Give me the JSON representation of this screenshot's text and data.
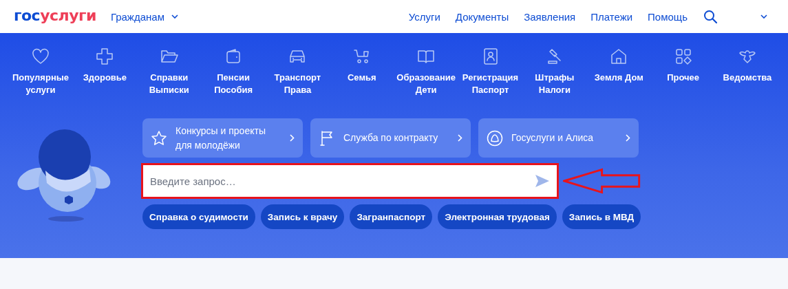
{
  "header": {
    "logo": {
      "prefix": "гос",
      "suffix": "услуги"
    },
    "audience": {
      "label": "Гражданам"
    },
    "nav": [
      "Услуги",
      "Документы",
      "Заявления",
      "Платежи",
      "Помощь"
    ]
  },
  "categories": [
    {
      "label": "Популярные услуги"
    },
    {
      "label": "Здоровье"
    },
    {
      "label": "Справки Выписки"
    },
    {
      "label": "Пенсии Пособия"
    },
    {
      "label": "Транспорт Права"
    },
    {
      "label": "Семья"
    },
    {
      "label": "Образование Дети"
    },
    {
      "label": "Регистрация Паспорт"
    },
    {
      "label": "Штрафы Налоги"
    },
    {
      "label": "Земля Дом"
    },
    {
      "label": "Прочее"
    },
    {
      "label": "Ведомства"
    }
  ],
  "promo_cards": [
    {
      "label": "Конкурсы и проекты для молодёжи"
    },
    {
      "label": "Служба по контракту"
    },
    {
      "label": "Госуслуги и Алиса"
    }
  ],
  "search": {
    "placeholder": "Введите запрос…",
    "highlighted": true
  },
  "quick_links": [
    "Справка о судимости",
    "Запись к врачу",
    "Загранпаспорт",
    "Электронная трудовая",
    "Запись в МВД"
  ]
}
